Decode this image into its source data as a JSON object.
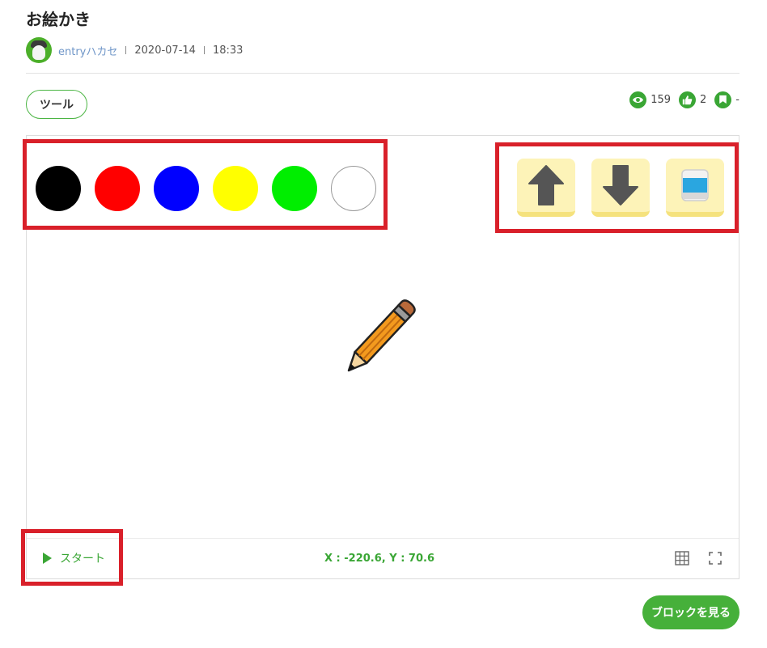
{
  "page": {
    "title": "お絵かき"
  },
  "meta": {
    "author": "entryハカセ",
    "date": "2020-07-14",
    "time": "18:33"
  },
  "tag": {
    "label": "ツール"
  },
  "stats": {
    "views": "159",
    "likes": "2",
    "bookmarks": "-"
  },
  "palette": {
    "colors": [
      {
        "name": "black",
        "hex": "#000000"
      },
      {
        "name": "red",
        "hex": "#ff0000"
      },
      {
        "name": "blue",
        "hex": "#0000ff"
      },
      {
        "name": "yellow",
        "hex": "#ffff00"
      },
      {
        "name": "green",
        "hex": "#00ee00"
      },
      {
        "name": "white",
        "hex": "#ffffff"
      }
    ]
  },
  "tools": [
    {
      "name": "pen-up",
      "icon": "arrow-up-icon"
    },
    {
      "name": "pen-down",
      "icon": "arrow-down-icon"
    },
    {
      "name": "eraser",
      "icon": "eraser-icon"
    }
  ],
  "player": {
    "start_label": "スタート",
    "coordinates": "X : -220.6, Y : 70.6"
  },
  "footer": {
    "view_blocks_label": "ブロックを見る"
  },
  "theme": {
    "accent": "#46b03a",
    "highlight": "#d9202a"
  }
}
